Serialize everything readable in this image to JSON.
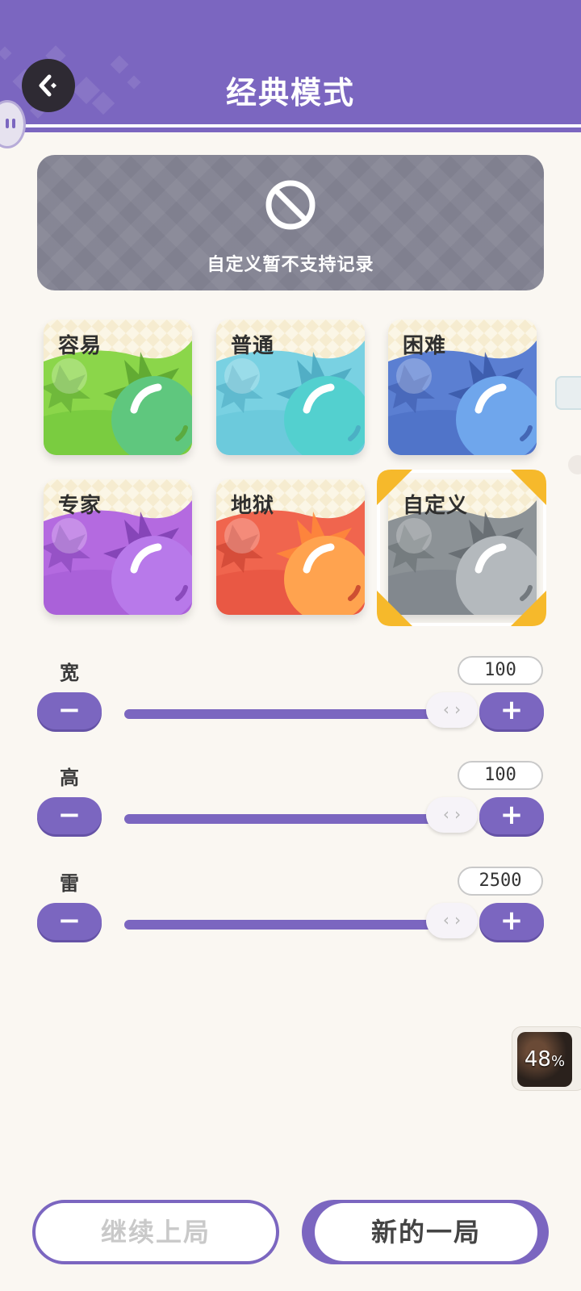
{
  "header": {
    "title": "经典模式",
    "color": "#7b66c0",
    "back_icon": "back-arrow-icon",
    "pause_icon": "pause-icon"
  },
  "banner": {
    "icon": "no-entry-icon",
    "text": "自定义暂不支持记录"
  },
  "difficulties": [
    {
      "label": "容易",
      "bg": "#8bd64a",
      "wave": "#6fc43a",
      "dark": "#5aa32f",
      "ball": "#5fc77e"
    },
    {
      "label": "普通",
      "bg": "#79d1e2",
      "wave": "#64c4d8",
      "dark": "#4aa8c0",
      "ball": "#53d0cf"
    },
    {
      "label": "困难",
      "bg": "#5b7fd2",
      "wave": "#4a6dc3",
      "dark": "#3a58a8",
      "ball": "#6fa6ec"
    },
    {
      "label": "专家",
      "bg": "#b46ae0",
      "wave": "#a35bd3",
      "dark": "#7e3eb0",
      "ball": "#b879ea"
    },
    {
      "label": "地狱",
      "bg": "#f0654e",
      "wave": "#e4503d",
      "dark": "#c13a2a",
      "ball": "#ffa34f",
      "spike": "#ff8a3a"
    },
    {
      "label": "自定义",
      "bg": "#8c9296",
      "wave": "#7c8288",
      "dark": "#63696e",
      "ball": "#b4b9bd",
      "selected": true
    }
  ],
  "sliders": [
    {
      "label": "宽",
      "value": "100",
      "minus": "−",
      "plus": "+",
      "thumb": "‹ ›"
    },
    {
      "label": "高",
      "value": "100",
      "minus": "−",
      "plus": "+",
      "thumb": "‹ ›"
    },
    {
      "label": "雷",
      "value": "2500",
      "minus": "−",
      "plus": "+",
      "thumb": "‹ ›"
    }
  ],
  "progress_widget": {
    "value": "48",
    "unit": "%"
  },
  "buttons": {
    "continue": "继续上局",
    "new_game": "新的一局"
  }
}
